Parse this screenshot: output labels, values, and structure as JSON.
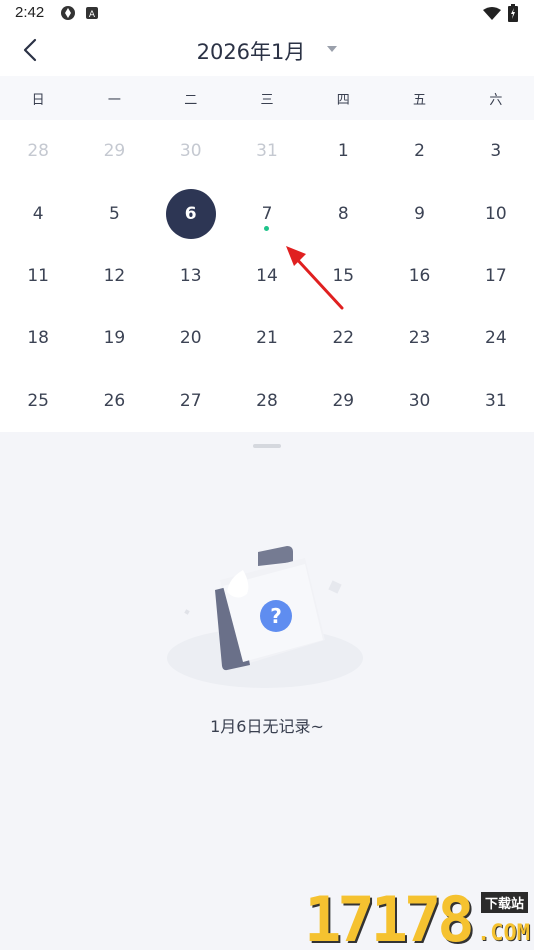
{
  "status_bar": {
    "time": "2:42",
    "icons": [
      "sync-icon",
      "app-a-icon",
      "wifi-icon",
      "battery-charging-icon"
    ]
  },
  "header": {
    "title": "2026年1月",
    "back_icon": "chevron-left-icon",
    "dropdown_icon": "caret-down-icon"
  },
  "calendar": {
    "weekdays": [
      "日",
      "一",
      "二",
      "三",
      "四",
      "五",
      "六"
    ],
    "days": [
      {
        "label": "28",
        "muted": true
      },
      {
        "label": "29",
        "muted": true
      },
      {
        "label": "30",
        "muted": true
      },
      {
        "label": "31",
        "muted": true
      },
      {
        "label": "1"
      },
      {
        "label": "2"
      },
      {
        "label": "3"
      },
      {
        "label": "4"
      },
      {
        "label": "5"
      },
      {
        "label": "6",
        "selected": true
      },
      {
        "label": "7",
        "has_record": true
      },
      {
        "label": "8"
      },
      {
        "label": "9"
      },
      {
        "label": "10"
      },
      {
        "label": "11"
      },
      {
        "label": "12"
      },
      {
        "label": "13"
      },
      {
        "label": "14"
      },
      {
        "label": "15"
      },
      {
        "label": "16"
      },
      {
        "label": "17"
      },
      {
        "label": "18"
      },
      {
        "label": "19"
      },
      {
        "label": "20"
      },
      {
        "label": "21"
      },
      {
        "label": "22"
      },
      {
        "label": "23"
      },
      {
        "label": "24"
      },
      {
        "label": "25"
      },
      {
        "label": "26"
      },
      {
        "label": "27"
      },
      {
        "label": "28"
      },
      {
        "label": "29"
      },
      {
        "label": "30"
      },
      {
        "label": "31"
      }
    ],
    "selected_color": "#2d3654",
    "record_dot_color": "#1fc38a"
  },
  "empty_state": {
    "message": "1月6日无记录~",
    "illustration_icon": "empty-folder-question-icon"
  },
  "watermark": {
    "digits": "17178",
    "tag": "下载站",
    "suffix": ".COM"
  }
}
